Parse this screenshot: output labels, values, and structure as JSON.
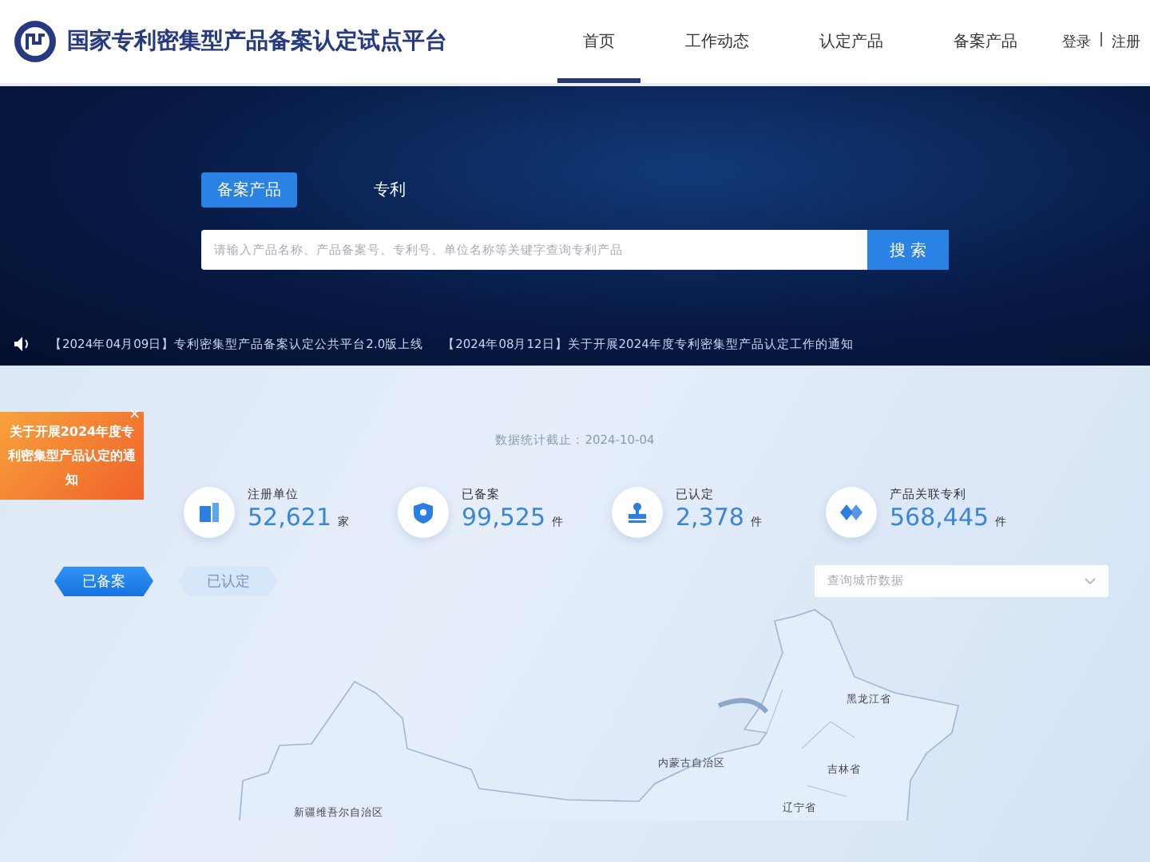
{
  "header": {
    "title": "国家专利密集型产品备案认定试点平台",
    "nav": [
      {
        "label": "首页",
        "selected": true
      },
      {
        "label": "工作动态",
        "selected": false
      },
      {
        "label": "认定产品",
        "selected": false
      },
      {
        "label": "备案产品",
        "selected": false
      }
    ],
    "auth": [
      "登录",
      "|",
      "注册"
    ]
  },
  "hero": {
    "search_tabs": [
      {
        "label": "备案产品",
        "selected": true
      },
      {
        "label": "专利",
        "selected": false
      }
    ],
    "search": {
      "placeholder": "请输入产品名称、产品备案号、专利号、单位名称等关键字查询专利产品",
      "button": "搜 索"
    },
    "news": [
      "【2024年04月09日】专利密集型产品备案认定公共平台2.0版上线",
      "【2024年08月12日】关于开展2024年度专利密集型产品认定工作的通知"
    ]
  },
  "notice": {
    "text": "关于开展2024年度专利密集型产品认定的通知",
    "close": "×"
  },
  "stats": {
    "date": "数据统计截止：2024-10-04",
    "items": [
      {
        "kind": "building",
        "label": "注册单位",
        "value": "52,621",
        "unit": "家"
      },
      {
        "kind": "shield",
        "label": "已备案",
        "value": "99,525",
        "unit": "件"
      },
      {
        "kind": "stamp",
        "label": "已认定",
        "value": "2,378",
        "unit": "件"
      },
      {
        "kind": "link",
        "label": "产品关联专利",
        "value": "568,445",
        "unit": "件"
      }
    ]
  },
  "map_tabs": [
    {
      "label": "已备案",
      "selected": true
    },
    {
      "label": "已认定",
      "selected": false
    }
  ],
  "city_select": {
    "placeholder": "查询城市数据"
  },
  "map": {
    "regions": [
      "黑龙江省",
      "内蒙古自治区",
      "吉林省",
      "新疆维吾尔自治区",
      "辽宁省"
    ]
  }
}
